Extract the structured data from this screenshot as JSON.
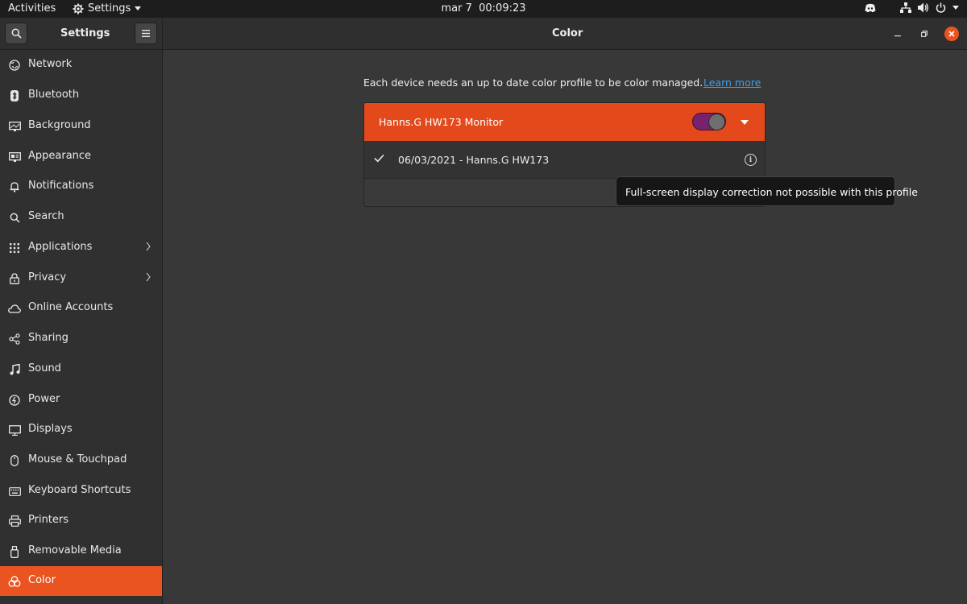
{
  "topbar": {
    "activities": "Activities",
    "app_name": "Settings",
    "date": "mar 7",
    "time": "00:09:23",
    "tray_icons": [
      "discord-icon",
      "network-icon",
      "volume-icon",
      "power-icon"
    ]
  },
  "window": {
    "sidebar_title": "Settings",
    "page_title": "Color"
  },
  "sidebar": {
    "items": [
      {
        "label": "Network",
        "icon": "network-icon"
      },
      {
        "label": "Bluetooth",
        "icon": "bluetooth-icon"
      },
      {
        "label": "Background",
        "icon": "background-icon"
      },
      {
        "label": "Appearance",
        "icon": "appearance-icon"
      },
      {
        "label": "Notifications",
        "icon": "bell-icon"
      },
      {
        "label": "Search",
        "icon": "search-icon"
      },
      {
        "label": "Applications",
        "icon": "grid-icon",
        "submenu": true
      },
      {
        "label": "Privacy",
        "icon": "lock-icon",
        "submenu": true
      },
      {
        "label": "Online Accounts",
        "icon": "cloud-icon"
      },
      {
        "label": "Sharing",
        "icon": "share-icon"
      },
      {
        "label": "Sound",
        "icon": "music-note-icon"
      },
      {
        "label": "Power",
        "icon": "power-icon"
      },
      {
        "label": "Displays",
        "icon": "display-icon"
      },
      {
        "label": "Mouse & Touchpad",
        "icon": "mouse-icon"
      },
      {
        "label": "Keyboard Shortcuts",
        "icon": "keyboard-icon"
      },
      {
        "label": "Printers",
        "icon": "printer-icon"
      },
      {
        "label": "Removable Media",
        "icon": "usb-icon"
      },
      {
        "label": "Color",
        "icon": "color-icon",
        "active": true
      }
    ]
  },
  "content": {
    "intro": "Each device needs an up to date color profile to be color managed.",
    "learn_more": "Learn more",
    "device": {
      "name": "Hanns.G HW173 Monitor",
      "enabled": true
    },
    "profile": {
      "name": "06/03/2021 - Hanns.G HW173",
      "selected": true
    },
    "tooltip": "Full-screen display correction not possible with this profile"
  },
  "colors": {
    "accent": "#e95420",
    "toggle_on": "#77216f",
    "link": "#3d9ee7"
  }
}
